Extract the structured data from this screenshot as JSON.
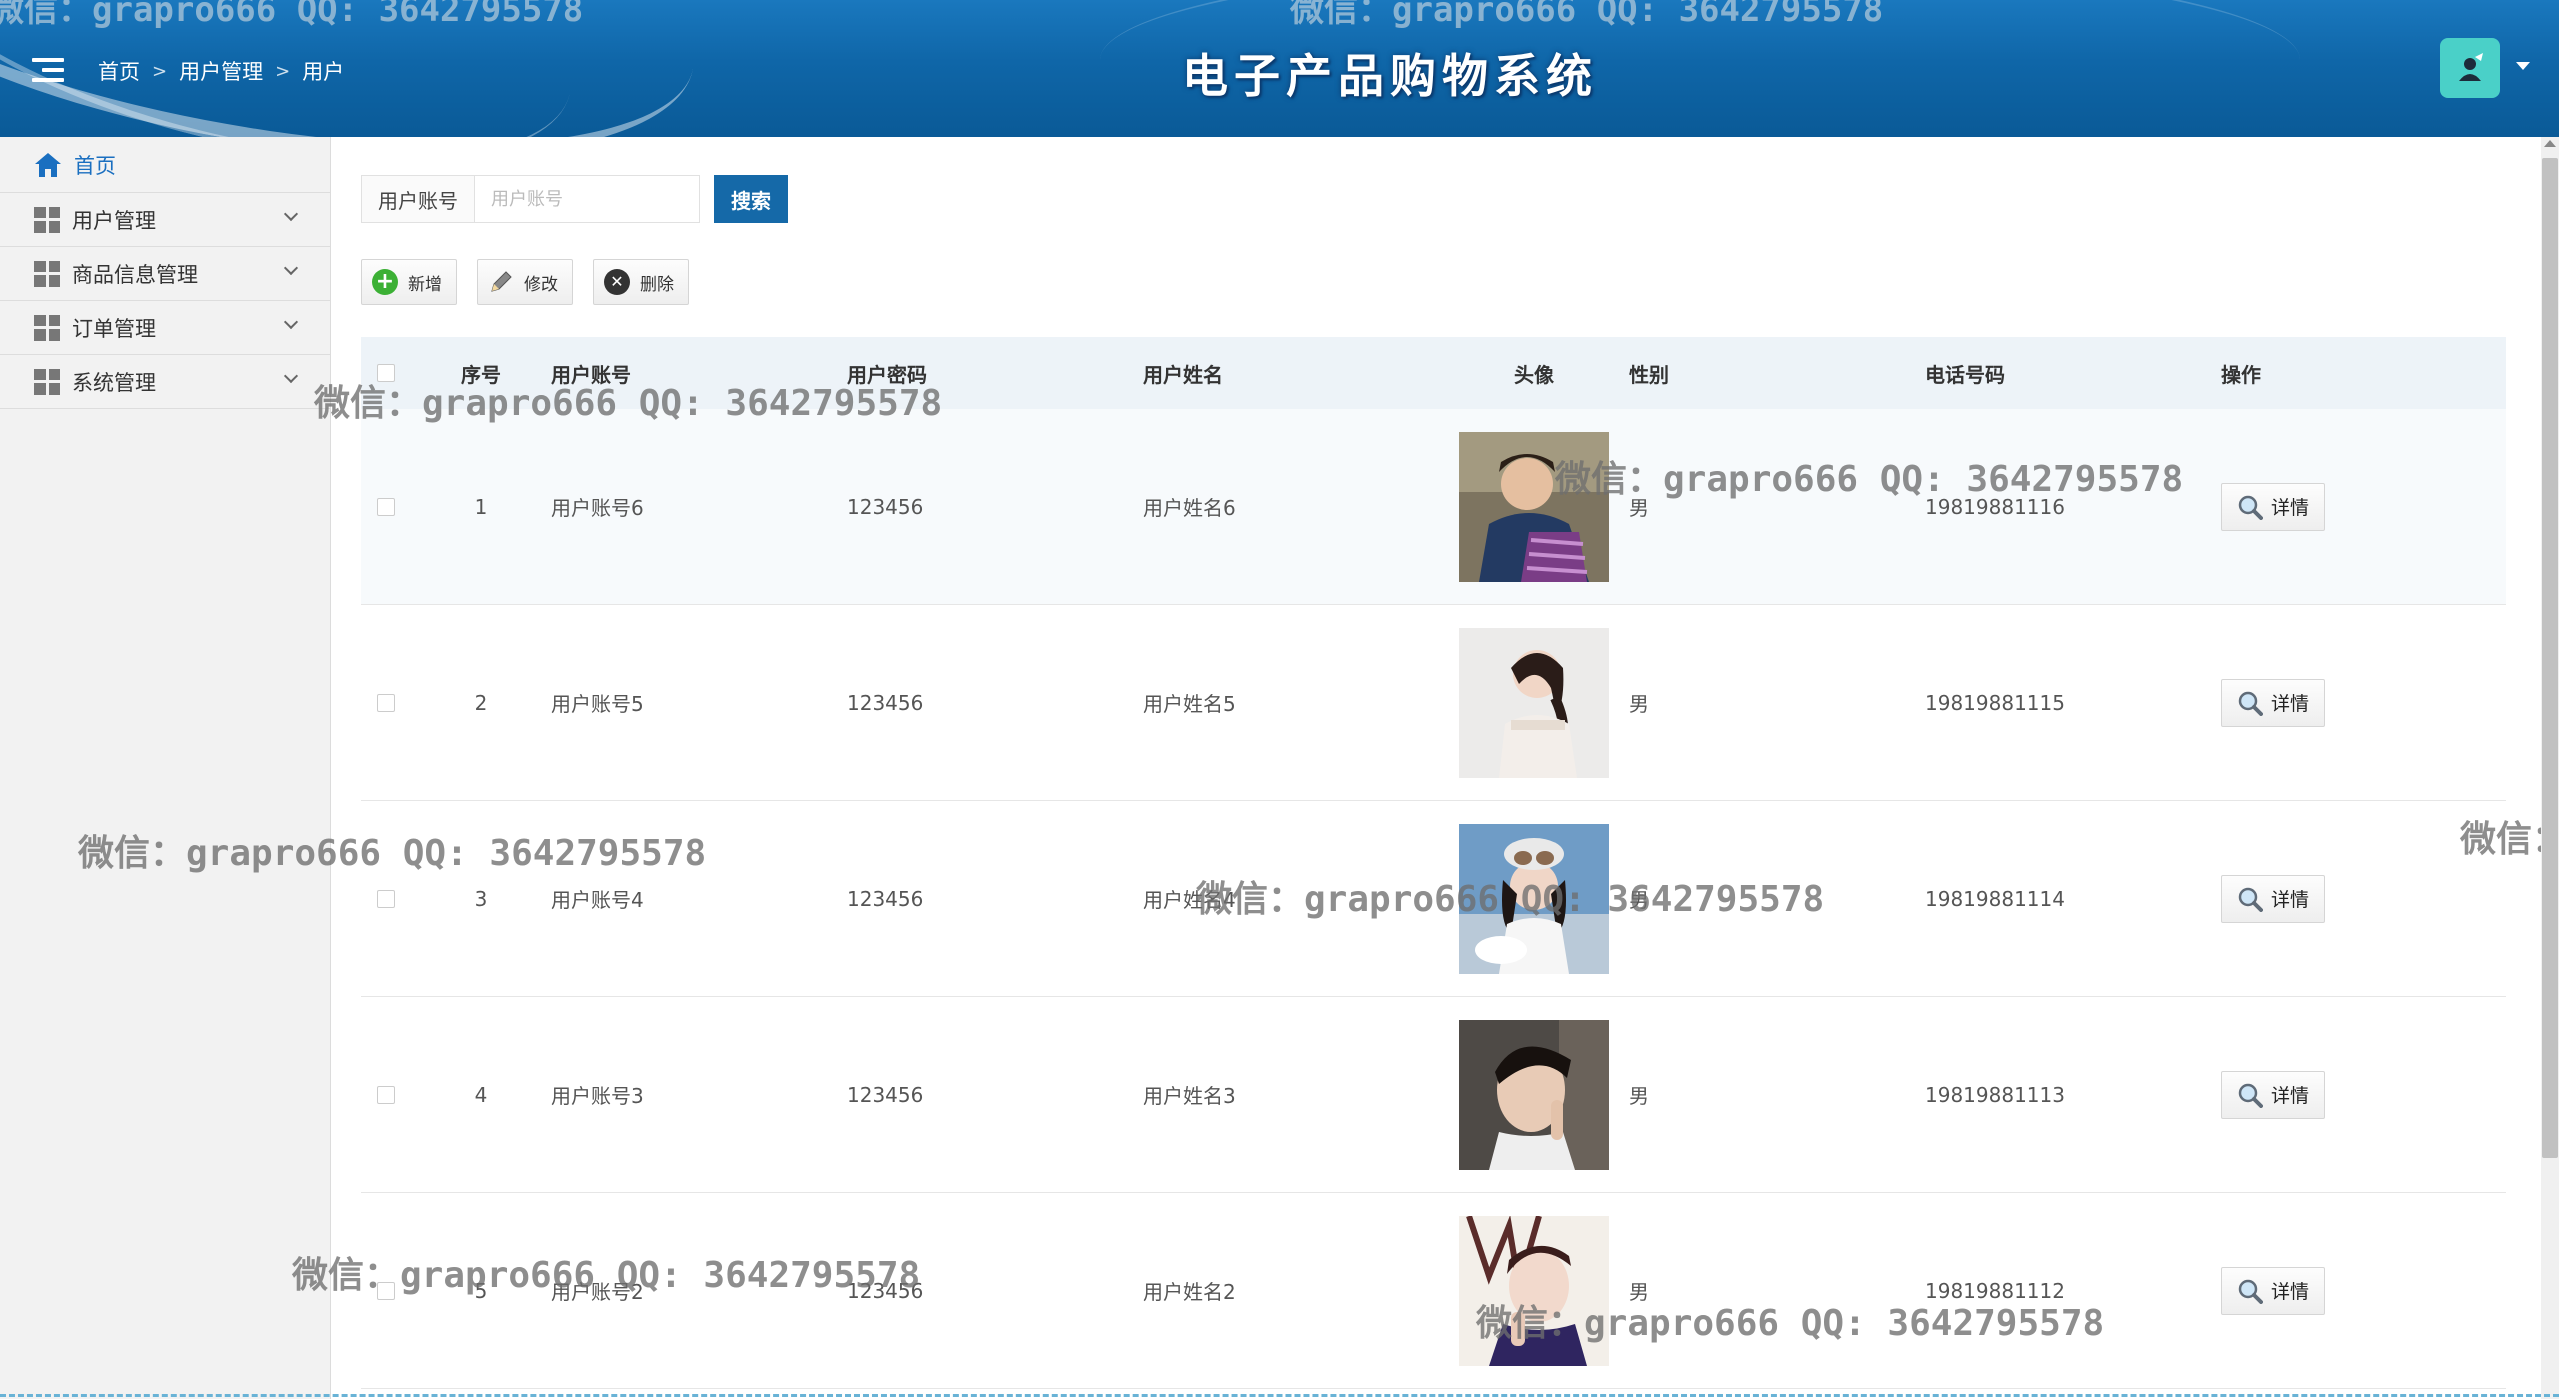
{
  "header": {
    "title": "电子产品购物系统",
    "breadcrumb": [
      "首页",
      "用户管理",
      "用户"
    ],
    "menu_icon": "hamburger-menu-icon",
    "avatar_icon": "user-avatar-icon"
  },
  "sidebar": {
    "items": [
      {
        "label": "首页",
        "icon": "home-icon"
      },
      {
        "label": "用户管理",
        "icon": "grid-icon"
      },
      {
        "label": "商品信息管理",
        "icon": "grid-icon"
      },
      {
        "label": "订单管理",
        "icon": "grid-icon"
      },
      {
        "label": "系统管理",
        "icon": "grid-icon"
      }
    ]
  },
  "search": {
    "label": "用户账号",
    "placeholder": "用户账号",
    "button": "搜索"
  },
  "toolbar": {
    "add": "新增",
    "edit": "修改",
    "delete": "删除"
  },
  "table": {
    "headers": [
      "序号",
      "用户账号",
      "用户密码",
      "用户姓名",
      "头像",
      "性别",
      "电话号码",
      "操作"
    ],
    "rows": [
      {
        "no": "1",
        "account": "用户账号6",
        "password": "123456",
        "name": "用户姓名6",
        "gender": "男",
        "phone": "19819881116",
        "action": "详情"
      },
      {
        "no": "2",
        "account": "用户账号5",
        "password": "123456",
        "name": "用户姓名5",
        "gender": "男",
        "phone": "19819881115",
        "action": "详情"
      },
      {
        "no": "3",
        "account": "用户账号4",
        "password": "123456",
        "name": "用户姓名4",
        "gender": "男",
        "phone": "19819881114",
        "action": "详情"
      },
      {
        "no": "4",
        "account": "用户账号3",
        "password": "123456",
        "name": "用户姓名3",
        "gender": "男",
        "phone": "19819881113",
        "action": "详情"
      },
      {
        "no": "5",
        "account": "用户账号2",
        "password": "123456",
        "name": "用户姓名2",
        "gender": "男",
        "phone": "19819881112",
        "action": "详情"
      }
    ]
  },
  "watermark": "微信：grapro666 QQ: 3642795578",
  "colors": {
    "header_blue": "#0f66a8",
    "primary_button": "#1569a8",
    "sidebar_bg": "#f2f2f2",
    "table_header_bg": "#edf3f8",
    "home_link": "#1a6fc0"
  }
}
